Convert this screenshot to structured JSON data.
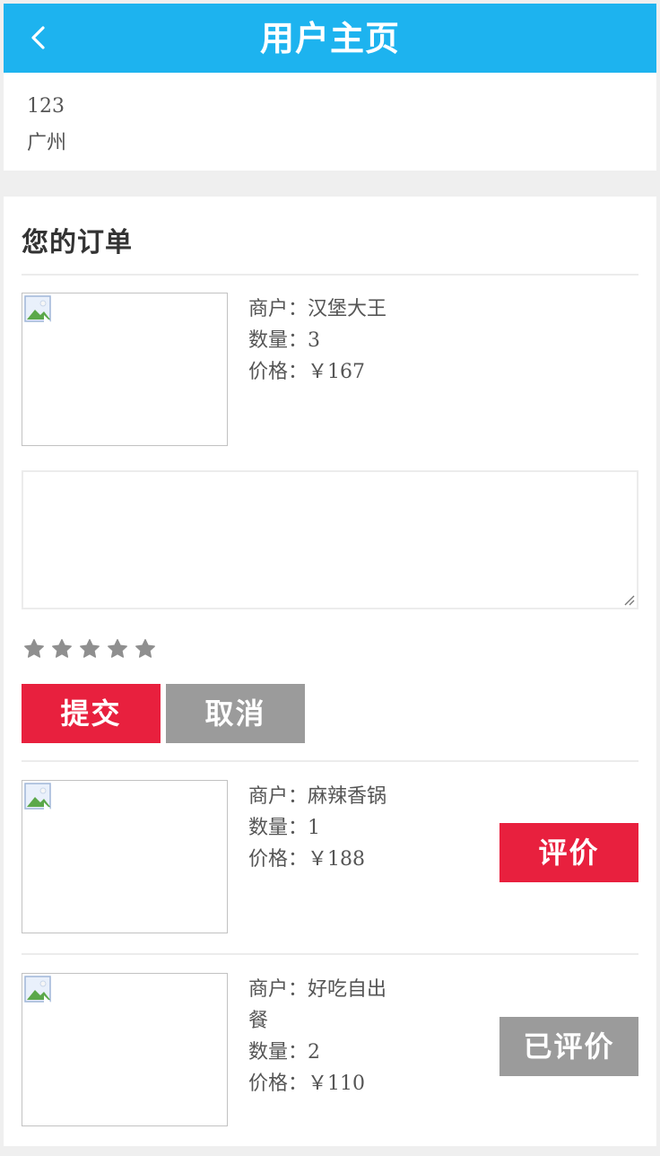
{
  "header": {
    "title": "用户主页",
    "back_icon": "chevron-left-icon"
  },
  "user": {
    "name": "123",
    "city": "广州"
  },
  "orders_section": {
    "title": "您的订单"
  },
  "orders": [
    {
      "merchant_label": "商户：汉堡大王",
      "quantity_label": "数量：3",
      "price_label": "价格：￥167",
      "review_form": {
        "comment_value": "",
        "rating": 0,
        "rating_max": 5,
        "submit_label": "提交",
        "cancel_label": "取消"
      }
    },
    {
      "merchant_label": "商户：麻辣香锅",
      "quantity_label": "数量：1",
      "price_label": "价格：￥188",
      "action_label": "评价"
    },
    {
      "merchant_label": "商户：好吃自出餐",
      "quantity_label": "数量：2",
      "price_label": "价格：￥110",
      "action_label": "已评价"
    }
  ],
  "colors": {
    "header_bg": "#1db3ef",
    "primary_red": "#e8203e",
    "disabled_gray": "#9b9b9b",
    "page_bg": "#efefef"
  }
}
